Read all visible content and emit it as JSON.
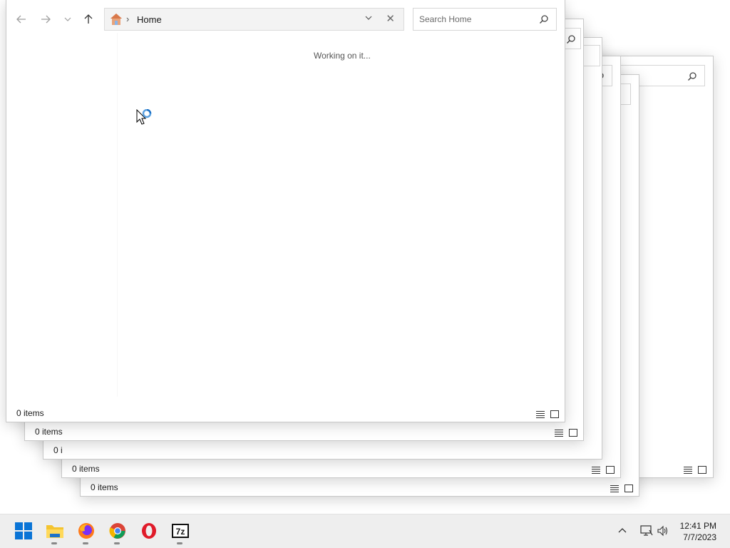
{
  "explorer": {
    "address_text": "Home",
    "search_placeholder": "Search Home",
    "working_text": "Working on it...",
    "status_items": "0 items"
  },
  "background_windows": {
    "status_items": "0 items",
    "status_items_truncated": "0 i"
  },
  "taskbar": {
    "apps": [
      {
        "name": "start-button",
        "icon": "windows-logo-icon"
      },
      {
        "name": "file-explorer",
        "icon": "folder-icon"
      },
      {
        "name": "firefox",
        "icon": "firefox-icon"
      },
      {
        "name": "chrome",
        "icon": "chrome-icon"
      },
      {
        "name": "opera",
        "icon": "opera-icon"
      },
      {
        "name": "7zip",
        "icon": "7zip-icon",
        "label": "7z"
      }
    ],
    "clock_time": "12:41 PM",
    "clock_date": "7/7/2023"
  },
  "colors": {
    "accent": "#0078d4",
    "taskbar_bg": "#eeeeee"
  }
}
